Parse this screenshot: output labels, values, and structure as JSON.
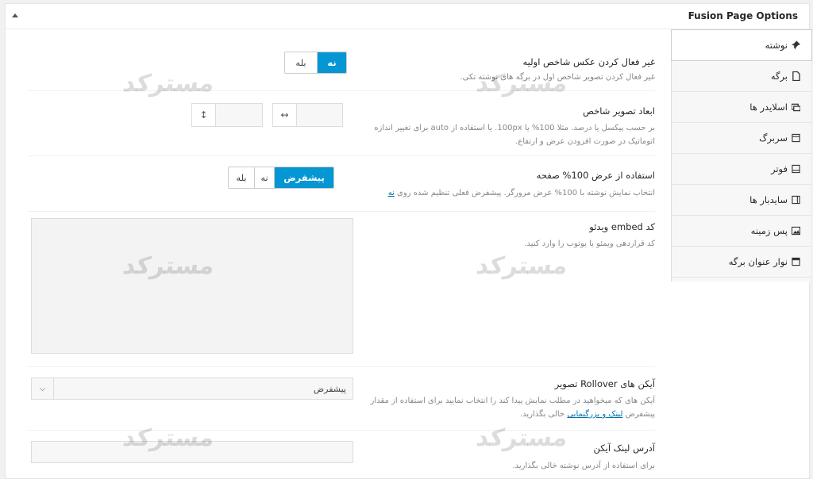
{
  "panel": {
    "title": "Fusion Page Options"
  },
  "sidebar": {
    "items": [
      {
        "label": "نوشته",
        "icon": "pin-icon"
      },
      {
        "label": "برگه",
        "icon": "page-icon"
      },
      {
        "label": "اسلایدر ها",
        "icon": "slider-icon"
      },
      {
        "label": "سربرگ",
        "icon": "header-icon"
      },
      {
        "label": "فوتر",
        "icon": "footer-icon"
      },
      {
        "label": "سایدبار ها",
        "icon": "sidebar-icon"
      },
      {
        "label": "پس زمینه",
        "icon": "image-icon"
      },
      {
        "label": "نوار عنوان برگه",
        "icon": "title-bar-icon"
      }
    ]
  },
  "options": {
    "featured_image": {
      "title": "غیر فعال کردن عکس شاخص اولیه",
      "desc": "غیر فعال کردن تصویر شاخص اول در برگه های نوشته تکی.",
      "yes": "بله",
      "no": "نه"
    },
    "dimensions": {
      "title": "ابعاد تصویر شاخص",
      "desc": "بر حسب پیکسل یا درصد. مثلا 100% یا 100px. یا استفاده از auto برای تغییر اندازه اتوماتیک در صورت افزودن عرض و ارتفاع.",
      "width_icon": "↔",
      "height_icon": "↕"
    },
    "full_width": {
      "title": "استفاده از عرض 100% صفحه",
      "desc_prefix": "انتخاب نمایش نوشته با 100% عرض مرورگر. پیشفرض فعلی تنظیم شده روی ",
      "desc_link": "نه",
      "default": "پیشفرض",
      "no": "نه",
      "yes": "بله"
    },
    "video": {
      "title": "کد embed ویدئو",
      "desc": "کد قراردهی ویمئو یا یوتوب را وارد کنید."
    },
    "rollover": {
      "title": "آیکن های Rollover تصویر",
      "desc_prefix": "آیکن های که میخواهید در مطلب نمایش پیدا کند را انتخاب نمایید برای استفاده از مقدار پیشفرض ",
      "desc_link": "لینک و بزرگنمایی",
      "desc_suffix": " خالی بگذارید.",
      "selected": "پیشفرض"
    },
    "link": {
      "title": "آدرس لینک آیکن",
      "desc": "برای استفاده از آدرس نوشته خالی بگذارید."
    }
  },
  "watermark": {
    "text": "مسترکد"
  }
}
